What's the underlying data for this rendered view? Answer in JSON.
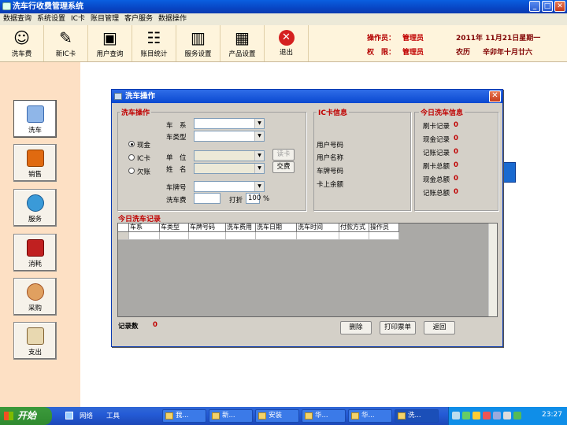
{
  "window": {
    "title": "洗车行收费管理系统",
    "minimize": "_",
    "maximize": "□",
    "close": "✕"
  },
  "menu": [
    "数据查询",
    "系统设置",
    "IC卡",
    "账目管理",
    "客户服务",
    "数据操作"
  ],
  "toolbar": [
    {
      "label": "洗车费",
      "icon": "person-icon"
    },
    {
      "label": "新IC卡",
      "icon": "card-icon"
    },
    {
      "label": "用户查询",
      "icon": "computer-user-icon"
    },
    {
      "label": "账目统计",
      "icon": "people-chart-icon"
    },
    {
      "label": "服务设置",
      "icon": "bar-chart-icon"
    },
    {
      "label": "产品设置",
      "icon": "product-box-icon"
    },
    {
      "label": "退出",
      "icon": "exit-icon"
    }
  ],
  "info": {
    "operator_label": "操作员：",
    "operator_value": "管理员",
    "perm_label": "权　限：",
    "perm_value": "管理员",
    "date": "2011年 11月21日星期一",
    "lunar_label": "农历",
    "lunar_date": "辛卯年十月廿六"
  },
  "sidebar": [
    {
      "label": "洗车",
      "icon": "car-icon",
      "active": true
    },
    {
      "label": "销售",
      "icon": "book-icon"
    },
    {
      "label": "服务",
      "icon": "globe-icon"
    },
    {
      "label": "消耗",
      "icon": "boat-icon"
    },
    {
      "label": "采购",
      "icon": "people-icon"
    },
    {
      "label": "支出",
      "icon": "hand-card-icon"
    }
  ],
  "dialog": {
    "title": "洗车操作",
    "wash_group": "洗车操作",
    "series_label": "车　系",
    "type_label": "车类型",
    "unit_label": "单　位",
    "name_label": "姓　名",
    "plate_label": "车牌号",
    "fee_label": "洗车费",
    "discount_label": "打折",
    "discount_value": "100",
    "percent": "%",
    "read_card": "读卡",
    "pay": "交费",
    "payment": {
      "cash": "现金",
      "ic": "IC卡",
      "credit": "欠账",
      "selected": "现金"
    },
    "ic_group": "IC卡信息",
    "ic_fields": [
      "用户号码",
      "用户名称",
      "车牌号码",
      "卡上余额"
    ],
    "today_group": "今日洗车信息",
    "today_stats": [
      {
        "label": "刷卡记录",
        "value": "0"
      },
      {
        "label": "现金记录",
        "value": "0"
      },
      {
        "label": "记账记录",
        "value": "0"
      },
      {
        "label": "刷卡总额",
        "value": "0"
      },
      {
        "label": "现金总额",
        "value": "0"
      },
      {
        "label": "记账总额",
        "value": "0"
      }
    ],
    "records_title": "今日洗车记录",
    "columns": [
      "车系",
      "车类型",
      "车牌号码",
      "洗车费用",
      "洗车日期",
      "洗车时间",
      "付款方式",
      "操作员"
    ],
    "record_count_label": "记录数",
    "record_count": "0",
    "delete": "删除",
    "print": "打印票单",
    "back": "返回"
  },
  "taskbar": {
    "start": "开始",
    "quick": [
      "网络",
      "工具"
    ],
    "tasks": [
      "我...",
      "新...",
      "安装",
      "华...",
      "华...",
      "洗..."
    ],
    "time": "23:27"
  }
}
